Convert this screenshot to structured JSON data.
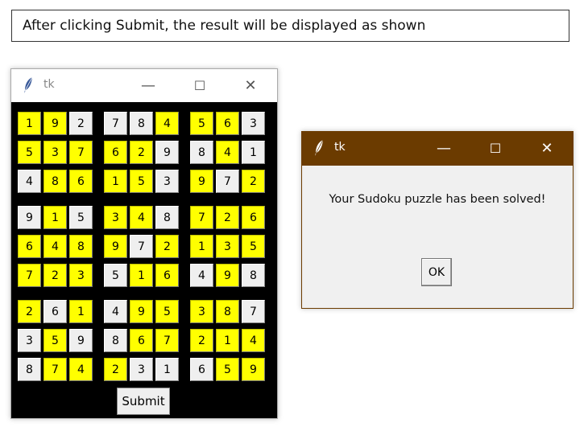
{
  "caption": "After clicking Submit, the result will be displayed as shown",
  "main_window": {
    "title": "tk",
    "minimize": "—",
    "maximize": "☐",
    "close": "✕",
    "submit_label": "Submit"
  },
  "dialog": {
    "title": "tk",
    "minimize": "—",
    "maximize": "☐",
    "close": "✕",
    "message": "Your Sudoku puzzle has been solved!",
    "ok_label": "OK"
  },
  "colors": {
    "filled": "#ffff00",
    "given": "#efefef",
    "dialog_titlebar": "#6b3b00"
  },
  "grid": [
    [
      1,
      9,
      2,
      7,
      8,
      4,
      5,
      6,
      3
    ],
    [
      5,
      3,
      7,
      6,
      2,
      9,
      8,
      4,
      1
    ],
    [
      4,
      8,
      6,
      1,
      5,
      3,
      9,
      7,
      2
    ],
    [
      9,
      1,
      5,
      3,
      4,
      8,
      7,
      2,
      6
    ],
    [
      6,
      4,
      8,
      9,
      7,
      2,
      1,
      3,
      5
    ],
    [
      7,
      2,
      3,
      5,
      1,
      6,
      4,
      9,
      8
    ],
    [
      2,
      6,
      1,
      4,
      9,
      5,
      3,
      8,
      7
    ],
    [
      3,
      5,
      9,
      8,
      6,
      7,
      2,
      1,
      4
    ],
    [
      8,
      7,
      4,
      2,
      3,
      1,
      6,
      5,
      9
    ]
  ],
  "cell_style": [
    [
      "y",
      "y",
      "w",
      "w",
      "w",
      "y",
      "y",
      "y",
      "w"
    ],
    [
      "y",
      "y",
      "y",
      "y",
      "y",
      "w",
      "w",
      "y",
      "w"
    ],
    [
      "w",
      "y",
      "y",
      "y",
      "y",
      "w",
      "y",
      "w",
      "y"
    ],
    [
      "w",
      "y",
      "w",
      "y",
      "y",
      "w",
      "y",
      "y",
      "y"
    ],
    [
      "y",
      "y",
      "y",
      "y",
      "w",
      "y",
      "y",
      "y",
      "y"
    ],
    [
      "y",
      "y",
      "y",
      "w",
      "y",
      "y",
      "w",
      "y",
      "w"
    ],
    [
      "y",
      "w",
      "y",
      "w",
      "y",
      "y",
      "y",
      "y",
      "w"
    ],
    [
      "w",
      "y",
      "w",
      "w",
      "y",
      "y",
      "y",
      "y",
      "y"
    ],
    [
      "w",
      "y",
      "y",
      "y",
      "w",
      "w",
      "w",
      "y",
      "y"
    ]
  ]
}
